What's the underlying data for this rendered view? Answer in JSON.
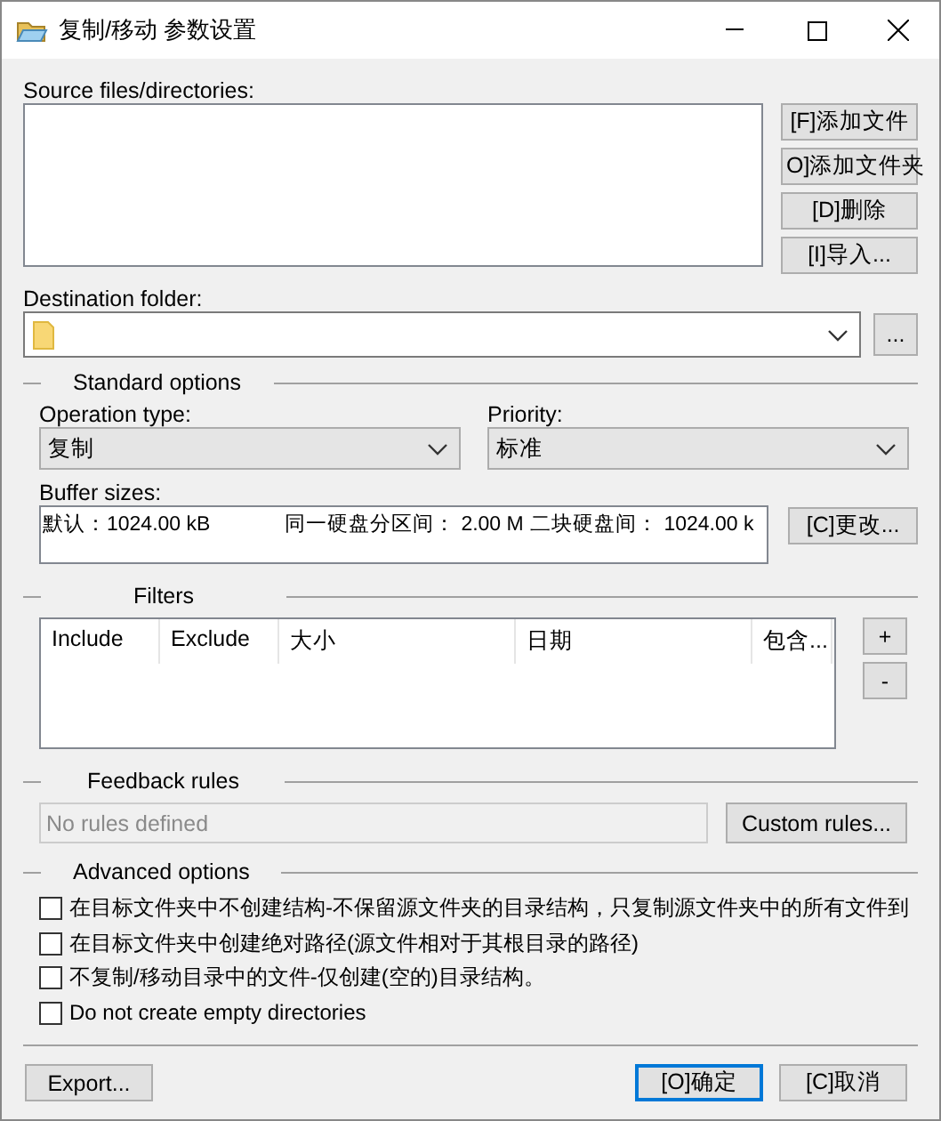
{
  "window": {
    "title": "复制/移动 参数设置"
  },
  "source": {
    "label": "Source files/directories:",
    "buttons": [
      "[F]添加文件",
      "O]添加文件夹",
      "[D]删除",
      "[I]导入..."
    ]
  },
  "destination": {
    "label": "Destination folder:",
    "browse": "..."
  },
  "standard": {
    "title": "Standard options",
    "operation_type": {
      "label": "Operation type:",
      "value": "复制"
    },
    "priority": {
      "label": "Priority:",
      "value": "标准"
    },
    "buffer": {
      "label": "Buffer sizes:",
      "entries": [
        "默认：1024.00 kB",
        "同一硬盘分区间： 2.00 M",
        "二块硬盘间： 1024.00 k"
      ],
      "button": "[C]更改..."
    }
  },
  "filters": {
    "title": "Filters",
    "columns": [
      "Include",
      "Exclude",
      "大小",
      "日期",
      "包含..."
    ],
    "add": "+",
    "remove": "-"
  },
  "feedback": {
    "title": "Feedback rules",
    "placeholder": "No rules defined",
    "button": "Custom rules..."
  },
  "advanced": {
    "title": "Advanced options",
    "options": [
      {
        "label": "在目标文件夹中不创建结构-不保留源文件夹的目录结构，只复制源文件夹中的所有文件到",
        "checked": false
      },
      {
        "label": "在目标文件夹中创建绝对路径(源文件相对于其根目录的路径)",
        "checked": false
      },
      {
        "label": "不复制/移动目录中的文件-仅创建(空的)目录结构。",
        "checked": false
      },
      {
        "label": "Do not create empty directories",
        "checked": false
      }
    ]
  },
  "footer": {
    "export": "Export...",
    "ok": "[O]确定",
    "cancel": "[C]取消"
  }
}
